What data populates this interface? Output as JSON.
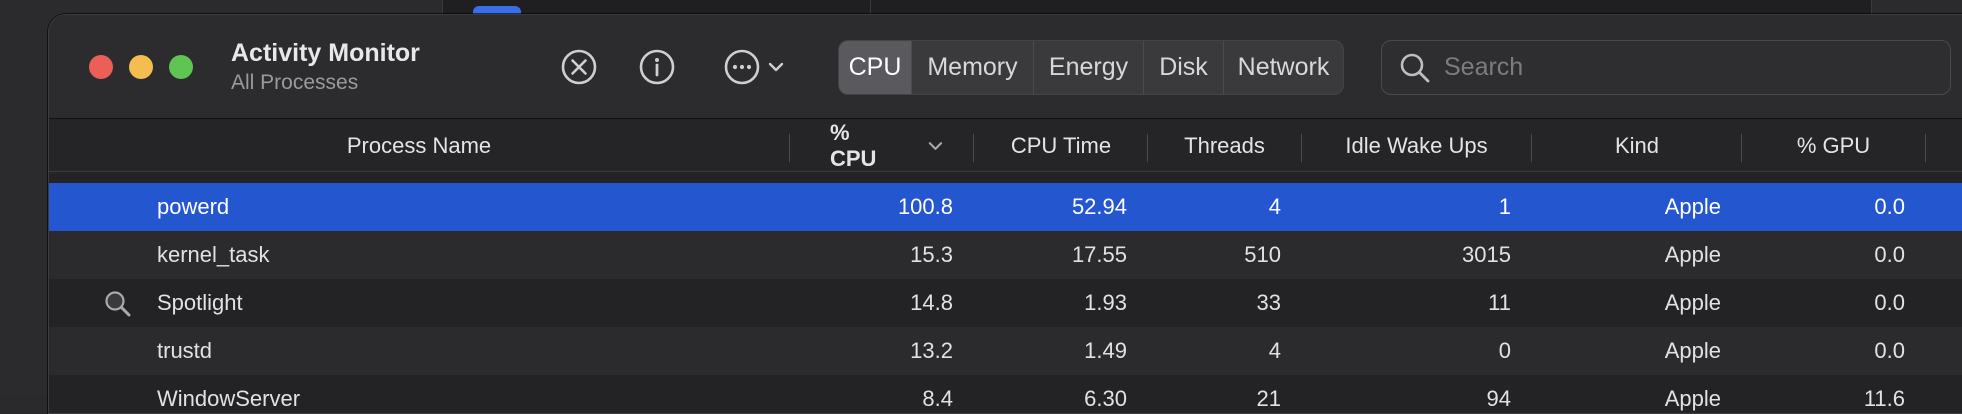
{
  "app": {
    "title": "Activity Monitor",
    "subtitle": "All Processes"
  },
  "toolbar": {
    "stop_icon": "x-circle-icon",
    "info_icon": "info-icon",
    "more_icon": "ellipsis-circle-icon"
  },
  "tabs": [
    "CPU",
    "Memory",
    "Energy",
    "Disk",
    "Network"
  ],
  "active_tab": "CPU",
  "search": {
    "placeholder": "Search",
    "value": ""
  },
  "columns": [
    "Process Name",
    "% CPU",
    "CPU Time",
    "Threads",
    "Idle Wake Ups",
    "Kind",
    "% GPU"
  ],
  "sorted_column": "% CPU",
  "processes": [
    {
      "name": "powerd",
      "cpu": "100.8",
      "cpu_time": "52.94",
      "threads": "4",
      "idle_wake_ups": "1",
      "kind": "Apple",
      "gpu": "0.0",
      "icon": ""
    },
    {
      "name": "kernel_task",
      "cpu": "15.3",
      "cpu_time": "17.55",
      "threads": "510",
      "idle_wake_ups": "3015",
      "kind": "Apple",
      "gpu": "0.0",
      "icon": ""
    },
    {
      "name": "Spotlight",
      "cpu": "14.8",
      "cpu_time": "1.93",
      "threads": "33",
      "idle_wake_ups": "11",
      "kind": "Apple",
      "gpu": "0.0",
      "icon": "magnifier-icon"
    },
    {
      "name": "trustd",
      "cpu": "13.2",
      "cpu_time": "1.49",
      "threads": "4",
      "idle_wake_ups": "0",
      "kind": "Apple",
      "gpu": "0.0",
      "icon": ""
    },
    {
      "name": "WindowServer",
      "cpu": "8.4",
      "cpu_time": "6.30",
      "threads": "21",
      "idle_wake_ups": "94",
      "kind": "Apple",
      "gpu": "11.6",
      "icon": ""
    }
  ],
  "colors": {
    "selection": "#2456cf",
    "close": "#ec5f59",
    "minimize": "#f4bd4f",
    "zoom": "#5fc453"
  }
}
